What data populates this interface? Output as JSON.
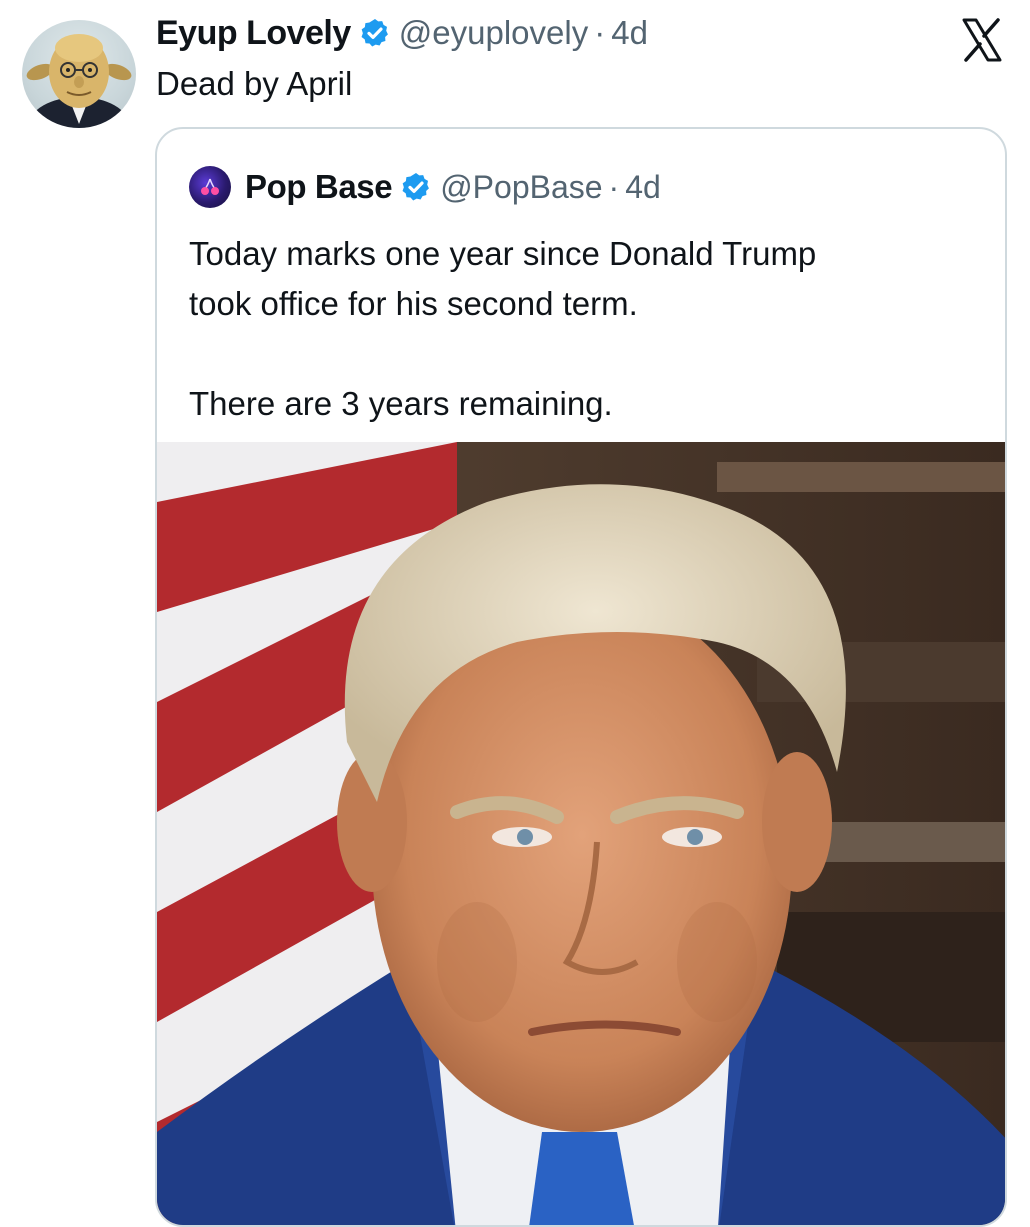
{
  "tweet": {
    "author_name": "Eyup Lovely",
    "author_handle": "@eyuplovely",
    "separator": "·",
    "time": "4d",
    "text": "Dead by April",
    "avatar_icon": "user-avatar",
    "verified_icon": "verified-badge-icon"
  },
  "quoted_tweet": {
    "author_name": "Pop Base",
    "author_handle": "@PopBase",
    "separator": "·",
    "time": "4d",
    "text": "Today marks one year since Donald Trump\ntook office for his second term.\n\nThere are 3 years remaining.",
    "image_icon": "portrait-photo",
    "verified_icon": "verified-badge-icon"
  },
  "app": {
    "logo_icon": "x-logo-icon"
  },
  "colors": {
    "verified": "#1d9bf0",
    "secondary_text": "#536471",
    "border": "#cfd9de"
  }
}
